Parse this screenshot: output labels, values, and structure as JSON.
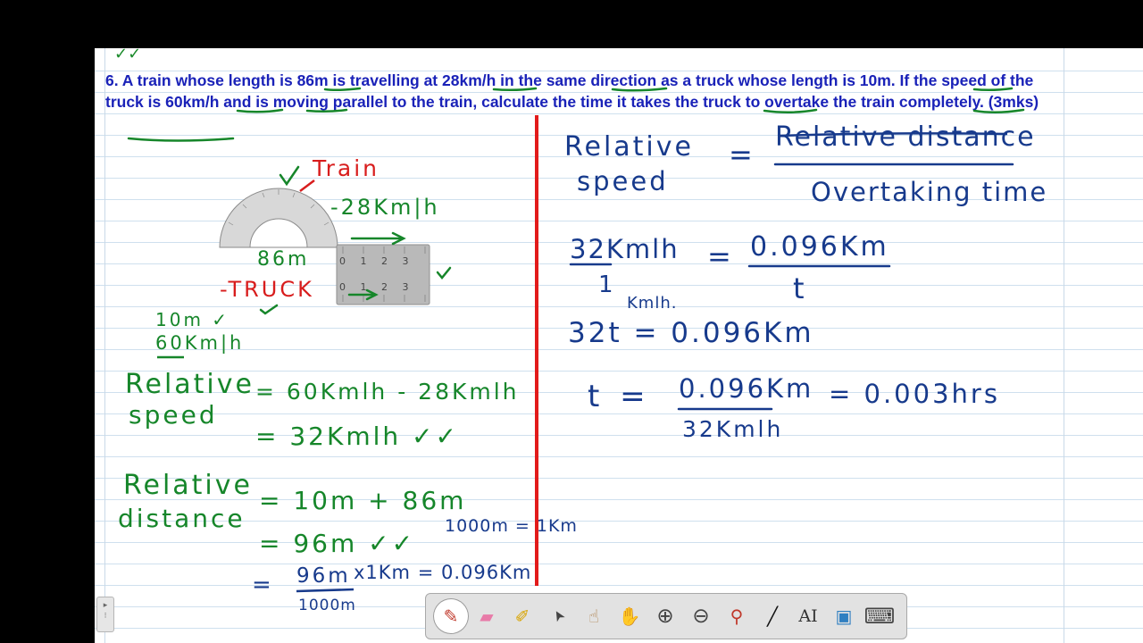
{
  "question": {
    "ticks": "✓✓",
    "text": "6. A train whose length is 86m is travelling at 28km/h in the same direction as a truck whose length is 10m. If the speed of the truck is 60km/h and is moving parallel to the train, calculate the time it takes the truck to overtake the train completely. (3mks)"
  },
  "left_notes": {
    "train_label": "Train",
    "speed_train": "-28Km|h",
    "length_train": "86m",
    "truck_label": "-TRUCK",
    "length_truck": "10m ✓",
    "speed_truck": "60Km|h",
    "rel_speed_label_1": "Relative",
    "rel_speed_label_2": "speed",
    "rel_speed_line_1": "= 60Kmlh - 28Kmlh",
    "rel_speed_line_2": "= 32Kmlh ✓✓",
    "rel_dist_label_1": "Relative",
    "rel_dist_label_2": "distance",
    "rel_dist_line_1": "= 10m + 86m",
    "rel_dist_line_2": "= 96m ✓✓",
    "rel_dist_line_3_num": "96m",
    "rel_dist_line_3_den": "1000m",
    "rel_dist_line_3_rest": "x1Km = 0.096Km",
    "conversion": "1000m = 1Km"
  },
  "right_notes": {
    "formula_lhs_1": "Relative",
    "formula_lhs_2": "speed",
    "formula_eq": "=",
    "formula_num": "Relative distance",
    "formula_den": "Overtaking time",
    "step1_num": "32Kmlh",
    "step1_den": "1",
    "step1_eq": "=",
    "step1_rhs_num": "0.096Km",
    "step1_rhs_den": "t",
    "step2_unit": "Kmlh.",
    "step2": "32t = 0.096Km",
    "step3_lhs": "t =",
    "step3_num": "0.096Km",
    "step3_den": "32Kmlh",
    "step3_result": "= 0.003hrs"
  },
  "ruler": {
    "ticks": [
      "0",
      "1",
      "2",
      "3"
    ]
  },
  "sidebar_tab": {
    "arrow": "▸",
    "grip": "⁝"
  },
  "toolbar": {
    "tools": [
      {
        "name": "pen-tool",
        "glyph": "✎",
        "active": true
      },
      {
        "name": "eraser-tool",
        "glyph": "▰"
      },
      {
        "name": "highlighter-tool",
        "glyph": "✐"
      },
      {
        "name": "select-tool",
        "glyph": "➤"
      },
      {
        "name": "pointer-hand-tool",
        "glyph": "☝"
      },
      {
        "name": "pan-hand-tool",
        "glyph": "✋"
      },
      {
        "name": "zoom-in-tool",
        "glyph": "⊕"
      },
      {
        "name": "zoom-out-tool",
        "glyph": "⊖"
      },
      {
        "name": "eyedropper-tool",
        "glyph": "⚲"
      },
      {
        "name": "line-tool",
        "glyph": "╱"
      },
      {
        "name": "text-tool",
        "glyph": "AI"
      },
      {
        "name": "screenshot-tool",
        "glyph": "▣"
      },
      {
        "name": "keyboard-tool",
        "glyph": "⌨"
      }
    ]
  },
  "colors": {
    "question_text": "#1a22b8",
    "ink_green": "#16862a",
    "ink_blue": "#173a8c",
    "ink_red": "#d81d1d",
    "divider": "#e21b1b"
  }
}
